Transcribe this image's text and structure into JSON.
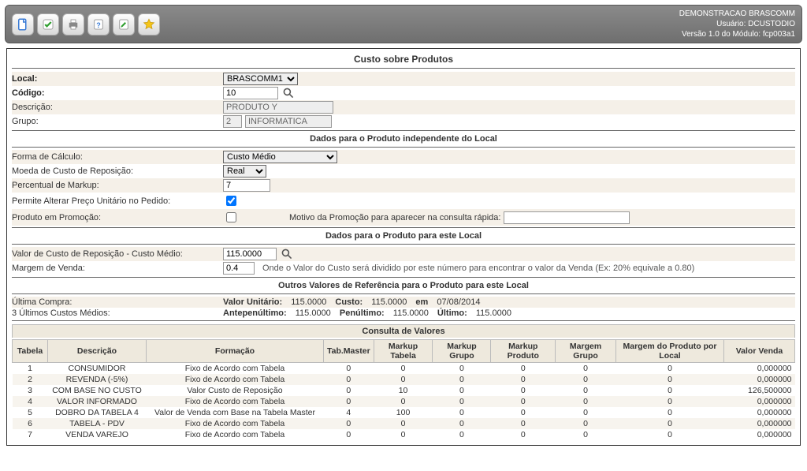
{
  "header": {
    "company": "DEMONSTRACAO BRASCOMM",
    "user_lbl": "Usuário:",
    "user": "DCUSTODIO",
    "ver_lbl": "Versão 1.0 do Módulo:",
    "module": "fcp003a1"
  },
  "page_title": "Custo sobre Produtos",
  "form": {
    "local_lbl": "Local:",
    "local_value": "BRASCOMM1",
    "codigo_lbl": "Código:",
    "codigo_value": "10",
    "descricao_lbl": "Descrição:",
    "descricao_value": "PRODUTO Y",
    "grupo_lbl": "Grupo:",
    "grupo_code": "2",
    "grupo_name": "INFORMATICA"
  },
  "sec1": {
    "title": "Dados para o Produto independente do Local",
    "forma_lbl": "Forma de Cálculo:",
    "forma_value": "Custo Médio",
    "moeda_lbl": "Moeda de Custo de Reposição:",
    "moeda_value": "Real",
    "markup_lbl": "Percentual de Markup:",
    "markup_value": "7",
    "permite_lbl": "Permite Alterar Preço Unitário no Pedido:",
    "promo_lbl": "Produto em Promoção:",
    "motivo_lbl": "Motivo da Promoção para aparecer na consulta rápida:",
    "motivo_value": ""
  },
  "sec2": {
    "title": "Dados para o Produto para este Local",
    "valorcusto_lbl": "Valor de Custo de Reposição - Custo Médio:",
    "valorcusto_value": "115.0000",
    "margem_lbl": "Margem de Venda:",
    "margem_value": "0.4",
    "margem_hint": "Onde o Valor do Custo será dividido por este número para encontrar o valor da Venda (Ex: 20% equivale a 0.80)"
  },
  "sec3": {
    "title": "Outros Valores de Referência para o Produto para este Local",
    "ultcompra_lbl": "Última Compra:",
    "valunit_lbl": "Valor Unitário:",
    "valunit": "115.0000",
    "custo_lbl": "Custo:",
    "custo": "115.0000",
    "em_lbl": "em",
    "data": "07/08/2014",
    "ult3_lbl": "3 Últimos Custos Médios:",
    "antepen_lbl": "Antepenúltimo:",
    "antepen": "115.0000",
    "penult_lbl": "Penúltimo:",
    "penult": "115.0000",
    "ultimo_lbl": "Último:",
    "ultimo": "115.0000"
  },
  "valtable": {
    "caption": "Consulta de Valores",
    "cols": [
      "Tabela",
      "Descrição",
      "Formação",
      "Tab.Master",
      "Markup Tabela",
      "Markup Grupo",
      "Markup Produto",
      "Margem Grupo",
      "Margem do Produto por Local",
      "Valor Venda"
    ],
    "rows": [
      {
        "t": "1",
        "d": "CONSUMIDOR",
        "f": "Fixo de Acordo com Tabela",
        "tm": "0",
        "mt": "0",
        "mg": "0",
        "mp": "0",
        "mgg": "0",
        "mpl": "0",
        "vv": "0,000000"
      },
      {
        "t": "2",
        "d": "REVENDA (-5%)",
        "f": "Fixo de Acordo com Tabela",
        "tm": "0",
        "mt": "0",
        "mg": "0",
        "mp": "0",
        "mgg": "0",
        "mpl": "0",
        "vv": "0,000000"
      },
      {
        "t": "3",
        "d": "COM BASE NO CUSTO",
        "f": "Valor Custo de Reposição",
        "tm": "0",
        "mt": "10",
        "mg": "0",
        "mp": "0",
        "mgg": "0",
        "mpl": "0",
        "vv": "126,500000"
      },
      {
        "t": "4",
        "d": "VALOR INFORMADO",
        "f": "Fixo de Acordo com Tabela",
        "tm": "0",
        "mt": "0",
        "mg": "0",
        "mp": "0",
        "mgg": "0",
        "mpl": "0",
        "vv": "0,000000"
      },
      {
        "t": "5",
        "d": "DOBRO DA TABELA 4",
        "f": "Valor de Venda com Base na Tabela Master",
        "tm": "4",
        "mt": "100",
        "mg": "0",
        "mp": "0",
        "mgg": "0",
        "mpl": "0",
        "vv": "0,000000"
      },
      {
        "t": "6",
        "d": "TABELA - PDV",
        "f": "Fixo de Acordo com Tabela",
        "tm": "0",
        "mt": "0",
        "mg": "0",
        "mp": "0",
        "mgg": "0",
        "mpl": "0",
        "vv": "0,000000"
      },
      {
        "t": "7",
        "d": "VENDA VAREJO",
        "f": "Fixo de Acordo com Tabela",
        "tm": "0",
        "mt": "0",
        "mg": "0",
        "mp": "0",
        "mgg": "0",
        "mpl": "0",
        "vv": "0,000000"
      }
    ]
  }
}
